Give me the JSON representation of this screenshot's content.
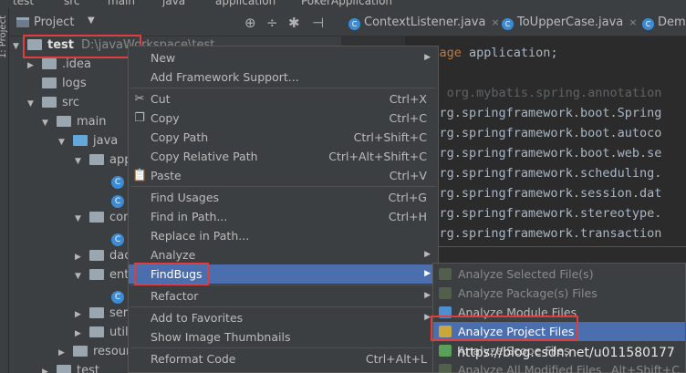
{
  "breadcrumb": [
    "test",
    "src",
    "main",
    "java",
    "application",
    "PokerApplication"
  ],
  "side_strip_label": "1: Project",
  "project_panel": {
    "title": "Project",
    "dropdown_glyph": "▼",
    "header_icons": [
      "⊕",
      "÷",
      "✱",
      "⊣"
    ]
  },
  "tree": [
    {
      "indent": 0,
      "arrow": "▼",
      "label": "test",
      "path": "D:\\javaWorkspace\\test",
      "kind": "module",
      "bold": true
    },
    {
      "indent": 1,
      "arrow": "▶",
      "label": ".idea",
      "kind": "folder"
    },
    {
      "indent": 1,
      "arrow": "",
      "label": "logs",
      "kind": "folder"
    },
    {
      "indent": 1,
      "arrow": "▼",
      "label": "src",
      "kind": "folder"
    },
    {
      "indent": 2,
      "arrow": "▼",
      "label": "main",
      "kind": "folder"
    },
    {
      "indent": 3,
      "arrow": "▼",
      "label": "java",
      "kind": "folder-blue"
    },
    {
      "indent": 4,
      "arrow": "▼",
      "label": "app",
      "kind": "folder"
    },
    {
      "indent": 5,
      "arrow": "",
      "label": "",
      "kind": "class"
    },
    {
      "indent": 5,
      "arrow": "",
      "label": "",
      "kind": "class"
    },
    {
      "indent": 4,
      "arrow": "▼",
      "label": "con",
      "kind": "folder"
    },
    {
      "indent": 5,
      "arrow": "",
      "label": "",
      "kind": "class"
    },
    {
      "indent": 4,
      "arrow": "▶",
      "label": "dac",
      "kind": "folder"
    },
    {
      "indent": 4,
      "arrow": "▼",
      "label": "enti",
      "kind": "folder"
    },
    {
      "indent": 5,
      "arrow": "",
      "label": "",
      "kind": "class"
    },
    {
      "indent": 4,
      "arrow": "▶",
      "label": "serv",
      "kind": "folder"
    },
    {
      "indent": 4,
      "arrow": "▶",
      "label": "util",
      "kind": "folder"
    },
    {
      "indent": 3,
      "arrow": "▶",
      "label": "resour",
      "kind": "folder"
    },
    {
      "indent": 2,
      "arrow": "▶",
      "label": "test",
      "kind": "folder"
    }
  ],
  "editor": {
    "tabs": [
      {
        "label": "ContextListener.java"
      },
      {
        "label": "ToUpperCase.java"
      },
      {
        "label": "Dem"
      }
    ],
    "code": [
      {
        "kw": "package",
        "text": " application;"
      },
      {
        "kw": "",
        "text": ""
      },
      {
        "kw": "",
        "text": "port org.mybatis.spring.annotation",
        "dim": true
      },
      {
        "kw": "rt",
        "text": " org.springframework.boot.Spring"
      },
      {
        "kw": "rt",
        "text": " org.springframework.boot.autoco"
      },
      {
        "kw": "rt",
        "text": " org.springframework.boot.web.se"
      },
      {
        "kw": "rt",
        "text": " org.springframework.scheduling."
      },
      {
        "kw": "rt",
        "text": " org.springframework.session.dat"
      },
      {
        "kw": "rt",
        "text": " org.springframework.stereotype."
      },
      {
        "kw": "rt",
        "text": " org.springframework.transaction"
      }
    ]
  },
  "context_menu": {
    "items": [
      {
        "label": "New",
        "underline": "N",
        "shortcut": "",
        "submenu": true,
        "icon": ""
      },
      {
        "label": "Add Framework Support...",
        "shortcut": "",
        "submenu": false,
        "icon": ""
      },
      {
        "sep": true
      },
      {
        "label": "Cut",
        "shortcut": "Ctrl+X",
        "icon": "✂"
      },
      {
        "label": "Copy",
        "shortcut": "Ctrl+C",
        "icon": "❐"
      },
      {
        "label": "Copy Path",
        "shortcut": "Ctrl+Shift+C",
        "icon": ""
      },
      {
        "label": "Copy Relative Path",
        "shortcut": "Ctrl+Alt+Shift+C",
        "icon": ""
      },
      {
        "label": "Paste",
        "shortcut": "Ctrl+V",
        "icon": "📋"
      },
      {
        "sep": true
      },
      {
        "label": "Find Usages",
        "shortcut": "Ctrl+G",
        "icon": ""
      },
      {
        "label": "Find in Path...",
        "shortcut": "Ctrl+H",
        "icon": ""
      },
      {
        "label": "Replace in Path...",
        "shortcut": "",
        "icon": ""
      },
      {
        "label": "Analyze",
        "shortcut": "",
        "submenu": true,
        "icon": ""
      },
      {
        "label": "FindBugs",
        "shortcut": "",
        "submenu": true,
        "icon": "",
        "selected": true
      },
      {
        "sep": true
      },
      {
        "label": "Refactor",
        "shortcut": "",
        "submenu": true,
        "icon": ""
      },
      {
        "sep": true
      },
      {
        "label": "Add to Favorites",
        "shortcut": "",
        "submenu": true,
        "icon": ""
      },
      {
        "label": "Show Image Thumbnails",
        "shortcut": "",
        "icon": ""
      },
      {
        "sep": true
      },
      {
        "label": "Reformat Code",
        "shortcut": "Ctrl+Alt+L",
        "icon": ""
      }
    ]
  },
  "findbugs_submenu": {
    "items": [
      {
        "label": "Analyze Selected File(s)",
        "enabled": false,
        "icon_color": "#6a7f5a"
      },
      {
        "label": "Analyze Package(s) Files",
        "enabled": false,
        "icon_color": "#6a7f5a"
      },
      {
        "label": "Analyze Module Files",
        "enabled": true,
        "icon_color": "#4e8fd1"
      },
      {
        "label": "Analyze Project Files",
        "enabled": true,
        "selected": true,
        "icon_color": "#c9a73a"
      },
      {
        "label": "Analyze Scope Files",
        "enabled": true,
        "icon_color": "#5aa05a"
      },
      {
        "label": "Analyze All Modified Files",
        "enabled": false,
        "shortcut": "Alt+Shift+C",
        "icon_color": "#6a7f5a"
      }
    ]
  },
  "watermark": "https://blog.csdn.net/u011580177",
  "colors": {
    "selection": "#4b6eaf",
    "highlight_box": "#e03d3d",
    "panel_bg": "#3c3f41",
    "editor_bg": "#2b2b2b"
  }
}
